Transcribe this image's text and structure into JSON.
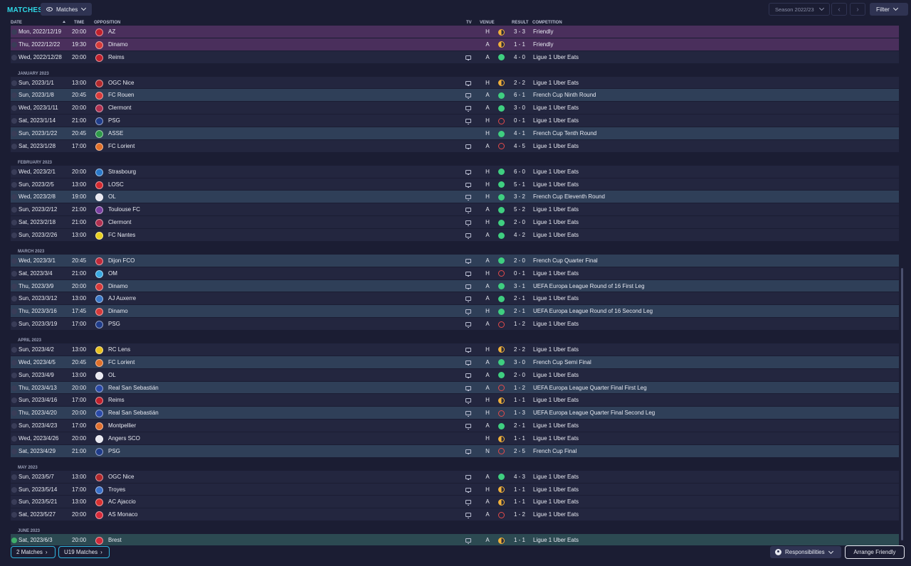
{
  "header": {
    "title": "MATCHES",
    "view_label": "Matches",
    "season_label": "Season 2022/23",
    "prev_symbol": "‹",
    "next_symbol": "›",
    "filter_label": "Filter"
  },
  "columns": {
    "date": "DATE",
    "time": "TIME",
    "opposition": "OPPOSITION",
    "tv": "TV",
    "venue": "VENUE",
    "result": "RESULT",
    "competition": "COMPETITION"
  },
  "colors": {
    "accent": "#2fd8e6",
    "win": "#3fcf80",
    "loss": "#e34a4a",
    "draw": "#f1b13a"
  },
  "rows": [
    {
      "kind": "match",
      "style": "friendly",
      "date": "Mon, 2022/12/19",
      "time": "20:00",
      "opp": "AZ",
      "badge": "#c0202c",
      "tv": false,
      "venue": "H",
      "res": "draw",
      "score": "3 - 3",
      "comp": "Friendly"
    },
    {
      "kind": "match",
      "style": "friendly",
      "date": "Thu, 2022/12/22",
      "time": "19:30",
      "opp": "Dinamo",
      "badge": "#d63a3a",
      "tv": false,
      "venue": "A",
      "res": "draw",
      "score": "1 - 1",
      "comp": "Friendly"
    },
    {
      "kind": "match",
      "style": "match",
      "date": "Wed, 2022/12/28",
      "time": "20:00",
      "opp": "Reims",
      "badge": "#c0202c",
      "tv": true,
      "venue": "A",
      "res": "win",
      "score": "4 - 0",
      "comp": "Ligue 1 Uber Eats"
    },
    {
      "kind": "month",
      "label": "JANUARY 2023"
    },
    {
      "kind": "match",
      "style": "match",
      "date": "Sun, 2023/1/1",
      "time": "13:00",
      "opp": "OGC Nice",
      "badge": "#b2282c",
      "tv": true,
      "venue": "H",
      "res": "draw",
      "score": "2 - 2",
      "comp": "Ligue 1 Uber Eats"
    },
    {
      "kind": "match",
      "style": "cup",
      "date": "Sun, 2023/1/8",
      "time": "20:45",
      "opp": "FC Rouen",
      "badge": "#d83a3a",
      "tv": true,
      "venue": "A",
      "res": "win",
      "score": "6 - 1",
      "comp": "French Cup Ninth Round"
    },
    {
      "kind": "match",
      "style": "match",
      "date": "Wed, 2023/1/11",
      "time": "20:00",
      "opp": "Clermont",
      "badge": "#b03050",
      "tv": true,
      "venue": "A",
      "res": "win",
      "score": "3 - 0",
      "comp": "Ligue 1 Uber Eats"
    },
    {
      "kind": "match",
      "style": "match",
      "date": "Sat, 2023/1/14",
      "time": "21:00",
      "opp": "PSG",
      "badge": "#1f3c8a",
      "tv": true,
      "venue": "H",
      "res": "loss",
      "score": "0 - 1",
      "comp": "Ligue 1 Uber Eats"
    },
    {
      "kind": "match",
      "style": "cup",
      "date": "Sun, 2023/1/22",
      "time": "20:45",
      "opp": "ASSE",
      "badge": "#2e9a4a",
      "tv": false,
      "venue": "H",
      "res": "win",
      "score": "4 - 1",
      "comp": "French Cup Tenth Round"
    },
    {
      "kind": "match",
      "style": "match",
      "date": "Sat, 2023/1/28",
      "time": "17:00",
      "opp": "FC Lorient",
      "badge": "#e0702a",
      "tv": true,
      "venue": "A",
      "res": "loss",
      "score": "4 - 5",
      "comp": "Ligue 1 Uber Eats"
    },
    {
      "kind": "month",
      "label": "FEBRUARY 2023"
    },
    {
      "kind": "match",
      "style": "match",
      "date": "Wed, 2023/2/1",
      "time": "20:00",
      "opp": "Strasbourg",
      "badge": "#2a78c8",
      "tv": true,
      "venue": "H",
      "res": "win",
      "score": "6 - 0",
      "comp": "Ligue 1 Uber Eats"
    },
    {
      "kind": "match",
      "style": "match",
      "date": "Sun, 2023/2/5",
      "time": "13:00",
      "opp": "LOSC",
      "badge": "#d42a30",
      "tv": true,
      "venue": "H",
      "res": "win",
      "score": "5 - 1",
      "comp": "Ligue 1 Uber Eats"
    },
    {
      "kind": "match",
      "style": "cup",
      "date": "Wed, 2023/2/8",
      "time": "19:00",
      "opp": "OL",
      "badge": "#e8e8f0",
      "tv": true,
      "venue": "H",
      "res": "win",
      "score": "3 - 2",
      "comp": "French Cup Eleventh Round"
    },
    {
      "kind": "match",
      "style": "match",
      "date": "Sun, 2023/2/12",
      "time": "21:00",
      "opp": "Toulouse FC",
      "badge": "#7a3ea0",
      "tv": true,
      "venue": "A",
      "res": "win",
      "score": "5 - 2",
      "comp": "Ligue 1 Uber Eats"
    },
    {
      "kind": "match",
      "style": "match",
      "date": "Sat, 2023/2/18",
      "time": "21:00",
      "opp": "Clermont",
      "badge": "#b03050",
      "tv": true,
      "venue": "H",
      "res": "win",
      "score": "2 - 0",
      "comp": "Ligue 1 Uber Eats"
    },
    {
      "kind": "match",
      "style": "match",
      "date": "Sun, 2023/2/26",
      "time": "13:00",
      "opp": "FC Nantes",
      "badge": "#e8d020",
      "tv": true,
      "venue": "A",
      "res": "win",
      "score": "4 - 2",
      "comp": "Ligue 1 Uber Eats"
    },
    {
      "kind": "month",
      "label": "MARCH 2023"
    },
    {
      "kind": "match",
      "style": "cup",
      "date": "Wed, 2023/3/1",
      "time": "20:45",
      "opp": "Dijon FCO",
      "badge": "#c02a3a",
      "tv": true,
      "venue": "A",
      "res": "win",
      "score": "2 - 0",
      "comp": "French Cup Quarter Final"
    },
    {
      "kind": "match",
      "style": "match",
      "date": "Sat, 2023/3/4",
      "time": "21:00",
      "opp": "OM",
      "badge": "#3aa8e0",
      "tv": true,
      "venue": "H",
      "res": "loss",
      "score": "0 - 1",
      "comp": "Ligue 1 Uber Eats"
    },
    {
      "kind": "match",
      "style": "cup",
      "date": "Thu, 2023/3/9",
      "time": "20:00",
      "opp": "Dinamo",
      "badge": "#d63a3a",
      "tv": true,
      "venue": "A",
      "res": "win",
      "score": "3 - 1",
      "comp": "UEFA Europa League Round of 16 First Leg"
    },
    {
      "kind": "match",
      "style": "match",
      "date": "Sun, 2023/3/12",
      "time": "13:00",
      "opp": "AJ Auxerre",
      "badge": "#3a78c8",
      "tv": true,
      "venue": "A",
      "res": "win",
      "score": "2 - 1",
      "comp": "Ligue 1 Uber Eats"
    },
    {
      "kind": "match",
      "style": "cup",
      "date": "Thu, 2023/3/16",
      "time": "17:45",
      "opp": "Dinamo",
      "badge": "#d63a3a",
      "tv": true,
      "venue": "H",
      "res": "win",
      "score": "2 - 1",
      "comp": "UEFA Europa League Round of 16 Second Leg"
    },
    {
      "kind": "match",
      "style": "match",
      "date": "Sun, 2023/3/19",
      "time": "17:00",
      "opp": "PSG",
      "badge": "#1f3c8a",
      "tv": true,
      "venue": "A",
      "res": "loss",
      "score": "1 - 2",
      "comp": "Ligue 1 Uber Eats"
    },
    {
      "kind": "month",
      "label": "APRIL 2023"
    },
    {
      "kind": "match",
      "style": "match",
      "date": "Sun, 2023/4/2",
      "time": "13:00",
      "opp": "RC Lens",
      "badge": "#e8c020",
      "tv": true,
      "venue": "H",
      "res": "draw",
      "score": "2 - 2",
      "comp": "Ligue 1 Uber Eats"
    },
    {
      "kind": "match",
      "style": "cup",
      "date": "Wed, 2023/4/5",
      "time": "20:45",
      "opp": "FC Lorient",
      "badge": "#e0702a",
      "tv": true,
      "venue": "A",
      "res": "win",
      "score": "3 - 0",
      "comp": "French Cup Semi Final"
    },
    {
      "kind": "match",
      "style": "match",
      "date": "Sun, 2023/4/9",
      "time": "13:00",
      "opp": "OL",
      "badge": "#e8e8f0",
      "tv": true,
      "venue": "A",
      "res": "win",
      "score": "2 - 0",
      "comp": "Ligue 1 Uber Eats"
    },
    {
      "kind": "match",
      "style": "cup",
      "date": "Thu, 2023/4/13",
      "time": "20:00",
      "opp": "Real San Sebastián",
      "badge": "#2a4aa8",
      "tv": true,
      "venue": "A",
      "res": "loss",
      "score": "1 - 2",
      "comp": "UEFA Europa League Quarter Final First Leg"
    },
    {
      "kind": "match",
      "style": "match",
      "date": "Sun, 2023/4/16",
      "time": "17:00",
      "opp": "Reims",
      "badge": "#c0202c",
      "tv": true,
      "venue": "H",
      "res": "draw",
      "score": "1 - 1",
      "comp": "Ligue 1 Uber Eats"
    },
    {
      "kind": "match",
      "style": "cup",
      "date": "Thu, 2023/4/20",
      "time": "20:00",
      "opp": "Real San Sebastián",
      "badge": "#2a4aa8",
      "tv": true,
      "venue": "H",
      "res": "loss",
      "score": "1 - 3",
      "comp": "UEFA Europa League Quarter Final Second Leg"
    },
    {
      "kind": "match",
      "style": "match",
      "date": "Sun, 2023/4/23",
      "time": "17:00",
      "opp": "Montpellier",
      "badge": "#e07030",
      "tv": true,
      "venue": "A",
      "res": "win",
      "score": "2 - 1",
      "comp": "Ligue 1 Uber Eats"
    },
    {
      "kind": "match",
      "style": "match",
      "date": "Wed, 2023/4/26",
      "time": "20:00",
      "opp": "Angers SCO",
      "badge": "#e8e8f0",
      "tv": false,
      "venue": "H",
      "res": "draw",
      "score": "1 - 1",
      "comp": "Ligue 1 Uber Eats"
    },
    {
      "kind": "match",
      "style": "cup",
      "date": "Sat, 2023/4/29",
      "time": "21:00",
      "opp": "PSG",
      "badge": "#1f3c8a",
      "tv": true,
      "venue": "N",
      "res": "loss",
      "score": "2 - 5",
      "comp": "French Cup Final"
    },
    {
      "kind": "month",
      "label": "MAY 2023"
    },
    {
      "kind": "match",
      "style": "match",
      "date": "Sun, 2023/5/7",
      "time": "13:00",
      "opp": "OGC Nice",
      "badge": "#b2282c",
      "tv": true,
      "venue": "A",
      "res": "win",
      "score": "4 - 3",
      "comp": "Ligue 1 Uber Eats"
    },
    {
      "kind": "match",
      "style": "match",
      "date": "Sun, 2023/5/14",
      "time": "17:00",
      "opp": "Troyes",
      "badge": "#3a70c8",
      "tv": true,
      "venue": "H",
      "res": "draw",
      "score": "1 - 1",
      "comp": "Ligue 1 Uber Eats"
    },
    {
      "kind": "match",
      "style": "match",
      "date": "Sun, 2023/5/21",
      "time": "13:00",
      "opp": "AC Ajaccio",
      "badge": "#d83030",
      "tv": true,
      "venue": "A",
      "res": "draw",
      "score": "1 - 1",
      "comp": "Ligue 1 Uber Eats"
    },
    {
      "kind": "match",
      "style": "match",
      "date": "Sat, 2023/5/27",
      "time": "20:00",
      "opp": "AS Monaco",
      "badge": "#d82a3a",
      "tv": true,
      "venue": "A",
      "res": "loss",
      "score": "1 - 2",
      "comp": "Ligue 1 Uber Eats"
    },
    {
      "kind": "month",
      "label": "JUNE 2023"
    },
    {
      "kind": "match",
      "style": "today",
      "date": "Sat, 2023/6/3",
      "time": "20:00",
      "opp": "Brest",
      "badge": "#d02a3a",
      "tv": true,
      "venue": "A",
      "res": "draw",
      "score": "1 - 1",
      "comp": "Ligue 1 Uber Eats"
    }
  ],
  "footer": {
    "btn1_label": "2 Matches",
    "btn2_label": "U19 Matches",
    "arrow_symbol": "›",
    "responsibilities_label": "Responsibilities",
    "arrange_label": "Arrange Friendly"
  }
}
